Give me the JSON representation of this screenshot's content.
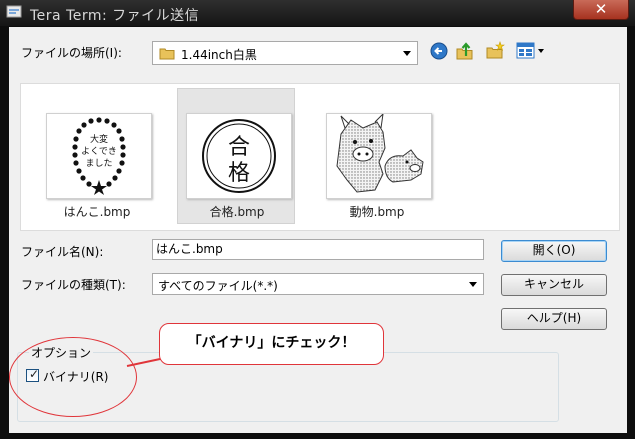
{
  "window": {
    "title": "Tera Term: ファイル送信",
    "close_glyph": "✕"
  },
  "location": {
    "label": "ファイルの場所(I):",
    "value": "1.44inch白黒"
  },
  "toolbar": {
    "back_icon": "back-arrow-icon",
    "up_icon": "up-folder-icon",
    "new_folder_icon": "new-folder-icon",
    "view_icon": "view-menu-icon"
  },
  "files": [
    {
      "name": "はんこ.bmp",
      "selected": false,
      "thumb_text": "大変よくできました"
    },
    {
      "name": "合格.bmp",
      "selected": true,
      "thumb_text": "合格"
    },
    {
      "name": "動物.bmp",
      "selected": false,
      "thumb_text": ""
    }
  ],
  "filename": {
    "label": "ファイル名(N):",
    "value": "はんこ.bmp"
  },
  "filetype": {
    "label": "ファイルの種類(T):",
    "value": "すべてのファイル(*.*)"
  },
  "buttons": {
    "open": "開く(O)",
    "cancel": "キャンセル",
    "help": "ヘルプ(H)"
  },
  "options": {
    "group_label": "オプション",
    "binary_label": "バイナリ(R)",
    "binary_checked": true
  },
  "callout": {
    "text": "「バイナリ」にチェック！"
  },
  "colors": {
    "accent": "#3b8bd1",
    "annotation": "#e0353a"
  }
}
